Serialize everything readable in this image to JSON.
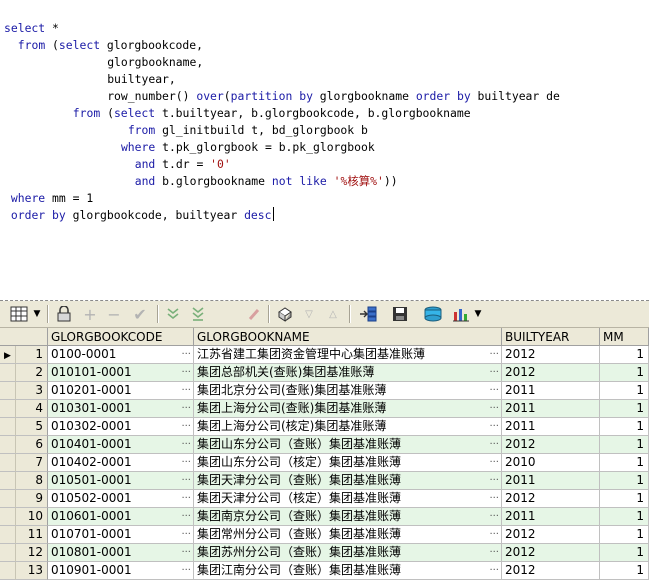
{
  "editor": {
    "lines": [
      {
        "indent": 0,
        "parts": [
          {
            "t": "select",
            "c": "kw"
          },
          {
            "t": " *"
          }
        ]
      },
      {
        "indent": 2,
        "parts": [
          {
            "t": "from",
            "c": "kw"
          },
          {
            "t": " (",
            "c": ""
          },
          {
            "t": "select",
            "c": "kw"
          },
          {
            "t": " glorgbookcode,"
          }
        ]
      },
      {
        "indent": 15,
        "parts": [
          {
            "t": "glorgbookname,"
          }
        ]
      },
      {
        "indent": 15,
        "parts": [
          {
            "t": "builtyear,"
          }
        ]
      },
      {
        "indent": 15,
        "parts": [
          {
            "t": "row_number() "
          },
          {
            "t": "over",
            "c": "kw"
          },
          {
            "t": "("
          },
          {
            "t": "partition by",
            "c": "kw"
          },
          {
            "t": " glorgbookname "
          },
          {
            "t": "order by",
            "c": "kw"
          },
          {
            "t": " builtyear de"
          }
        ]
      },
      {
        "indent": 10,
        "parts": [
          {
            "t": "from",
            "c": "kw"
          },
          {
            "t": " ("
          },
          {
            "t": "select",
            "c": "kw"
          },
          {
            "t": " t.builtyear, b.glorgbookcode, b.glorgbookname"
          }
        ]
      },
      {
        "indent": 18,
        "parts": [
          {
            "t": "from",
            "c": "kw"
          },
          {
            "t": " gl_initbuild t, bd_glorgbook b"
          }
        ]
      },
      {
        "indent": 17,
        "parts": [
          {
            "t": "where",
            "c": "kw"
          },
          {
            "t": " t.pk_glorgbook = b.pk_glorgbook"
          }
        ]
      },
      {
        "indent": 19,
        "parts": [
          {
            "t": "and",
            "c": "kw"
          },
          {
            "t": " t.dr = "
          },
          {
            "t": "'0'",
            "c": "str"
          }
        ]
      },
      {
        "indent": 19,
        "parts": [
          {
            "t": "and",
            "c": "kw"
          },
          {
            "t": " b.glorgbookname "
          },
          {
            "t": "not like",
            "c": "kw"
          },
          {
            "t": " "
          },
          {
            "t": "'%核算%'",
            "c": "str"
          },
          {
            "t": "))"
          }
        ]
      },
      {
        "indent": 1,
        "parts": [
          {
            "t": "where",
            "c": "kw"
          },
          {
            "t": " mm = "
          },
          {
            "t": "1",
            "c": "num"
          }
        ]
      },
      {
        "indent": 1,
        "parts": [
          {
            "t": "order by",
            "c": "kw"
          },
          {
            "t": " glorgbookcode, builtyear "
          },
          {
            "t": "desc",
            "c": "kw"
          }
        ],
        "caret": true
      }
    ]
  },
  "toolbar": {
    "icons": [
      "grid-select-icon",
      "dropdown-arrow-icon",
      "lock-icon",
      "add-record-icon",
      "delete-record-icon",
      "post-changes-icon",
      "next-page-icon",
      "last-page-icon",
      "clear-icon",
      "query-icon",
      "filter-down-icon",
      "filter-up-icon",
      "export-icon",
      "save-icon",
      "print-icon",
      "chart-icon"
    ]
  },
  "grid": {
    "columns": [
      "GLORGBOOKCODE",
      "GLORGBOOKNAME",
      "BUILTYEAR",
      "MM"
    ],
    "rows": [
      {
        "n": "1",
        "code": "0100-0001",
        "name": "江苏省建工集团资金管理中心集团基准账薄",
        "year": "2012",
        "mm": "1"
      },
      {
        "n": "2",
        "code": "010101-0001",
        "name": "集团总部机关(查账)集团基准账薄",
        "year": "2012",
        "mm": "1"
      },
      {
        "n": "3",
        "code": "010201-0001",
        "name": "集团北京分公司(查账)集团基准账薄",
        "year": "2011",
        "mm": "1"
      },
      {
        "n": "4",
        "code": "010301-0001",
        "name": "集团上海分公司(查账)集团基准账薄",
        "year": "2011",
        "mm": "1"
      },
      {
        "n": "5",
        "code": "010302-0001",
        "name": "集团上海分公司(核定)集团基准账薄",
        "year": "2011",
        "mm": "1"
      },
      {
        "n": "6",
        "code": "010401-0001",
        "name": "集团山东分公司（查账）集团基准账薄",
        "year": "2012",
        "mm": "1"
      },
      {
        "n": "7",
        "code": "010402-0001",
        "name": "集团山东分公司（核定）集团基准账薄",
        "year": "2010",
        "mm": "1"
      },
      {
        "n": "8",
        "code": "010501-0001",
        "name": "集团天津分公司（查账）集团基准账薄",
        "year": "2011",
        "mm": "1"
      },
      {
        "n": "9",
        "code": "010502-0001",
        "name": "集团天津分公司（核定）集团基准账薄",
        "year": "2012",
        "mm": "1"
      },
      {
        "n": "10",
        "code": "010601-0001",
        "name": "集团南京分公司（查账）集团基准账薄",
        "year": "2011",
        "mm": "1"
      },
      {
        "n": "11",
        "code": "010701-0001",
        "name": "集团常州分公司（查账）集团基准账薄",
        "year": "2012",
        "mm": "1"
      },
      {
        "n": "12",
        "code": "010801-0001",
        "name": "集团苏州分公司（查账）集团基准账薄",
        "year": "2012",
        "mm": "1"
      },
      {
        "n": "13",
        "code": "010901-0001",
        "name": "集团江南分公司（查账）集团基准账薄",
        "year": "2012",
        "mm": "1"
      }
    ],
    "ellipsis": "···",
    "row_indicator": "▶"
  }
}
